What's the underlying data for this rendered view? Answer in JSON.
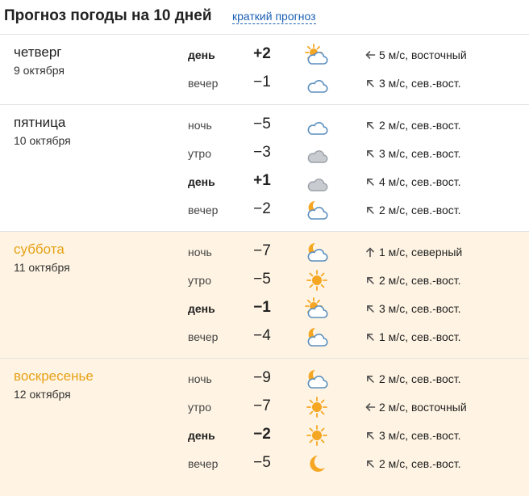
{
  "header": {
    "title": "Прогноз погоды на 10 дней",
    "short_link": "краткий прогноз"
  },
  "days": [
    {
      "name": "четверг",
      "date": "9 октября",
      "weekend": false,
      "rows": [
        {
          "period": "день",
          "temp": "+2",
          "icon": "sun-behind-cloud-icon",
          "wind_dir": "east",
          "wind": "5 м/с, восточный",
          "bold": true
        },
        {
          "period": "вечер",
          "temp": "−1",
          "icon": "cloud-icon",
          "wind_dir": "northeast",
          "wind": "3 м/с, сев.-вост.",
          "bold": false
        }
      ]
    },
    {
      "name": "пятница",
      "date": "10 октября",
      "weekend": false,
      "rows": [
        {
          "period": "ночь",
          "temp": "−5",
          "icon": "cloud-icon",
          "wind_dir": "northeast",
          "wind": "2 м/с, сев.-вост.",
          "bold": false
        },
        {
          "period": "утро",
          "temp": "−3",
          "icon": "overcast-cloud-icon",
          "wind_dir": "northeast",
          "wind": "3 м/с, сев.-вост.",
          "bold": false
        },
        {
          "period": "день",
          "temp": "+1",
          "icon": "overcast-cloud-icon",
          "wind_dir": "northeast",
          "wind": "4 м/с, сев.-вост.",
          "bold": true
        },
        {
          "period": "вечер",
          "temp": "−2",
          "icon": "moon-behind-cloud-icon",
          "wind_dir": "northeast",
          "wind": "2 м/с, сев.-вост.",
          "bold": false
        }
      ]
    },
    {
      "name": "суббота",
      "date": "11 октября",
      "weekend": true,
      "rows": [
        {
          "period": "ночь",
          "temp": "−7",
          "icon": "moon-behind-cloud-icon",
          "wind_dir": "north",
          "wind": "1 м/с, северный",
          "bold": false
        },
        {
          "period": "утро",
          "temp": "−5",
          "icon": "sun-icon",
          "wind_dir": "northeast",
          "wind": "2 м/с, сев.-вост.",
          "bold": false
        },
        {
          "period": "день",
          "temp": "−1",
          "icon": "sun-behind-cloud-icon",
          "wind_dir": "northeast",
          "wind": "3 м/с, сев.-вост.",
          "bold": true
        },
        {
          "period": "вечер",
          "temp": "−4",
          "icon": "moon-behind-cloud-icon",
          "wind_dir": "northeast",
          "wind": "1 м/с, сев.-вост.",
          "bold": false
        }
      ]
    },
    {
      "name": "воскресенье",
      "date": "12 октября",
      "weekend": true,
      "rows": [
        {
          "period": "ночь",
          "temp": "−9",
          "icon": "moon-behind-cloud-icon",
          "wind_dir": "northeast",
          "wind": "2 м/с, сев.-вост.",
          "bold": false
        },
        {
          "period": "утро",
          "temp": "−7",
          "icon": "sun-icon",
          "wind_dir": "east",
          "wind": "2 м/с, восточный",
          "bold": false
        },
        {
          "period": "день",
          "temp": "−2",
          "icon": "sun-icon",
          "wind_dir": "northeast",
          "wind": "3 м/с, сев.-вост.",
          "bold": true
        },
        {
          "period": "вечер",
          "temp": "−5",
          "icon": "moon-icon",
          "wind_dir": "northeast",
          "wind": "2 м/с, сев.-вост.",
          "bold": false
        }
      ]
    }
  ],
  "colors": {
    "weekend_background": "#fff4e3",
    "weekend_day_name": "#e6a117",
    "link": "#1a5fb4",
    "sun": "#f5a623",
    "cloud_outline": "#5b8fbf",
    "overcast_fill": "#c8ccd1"
  }
}
